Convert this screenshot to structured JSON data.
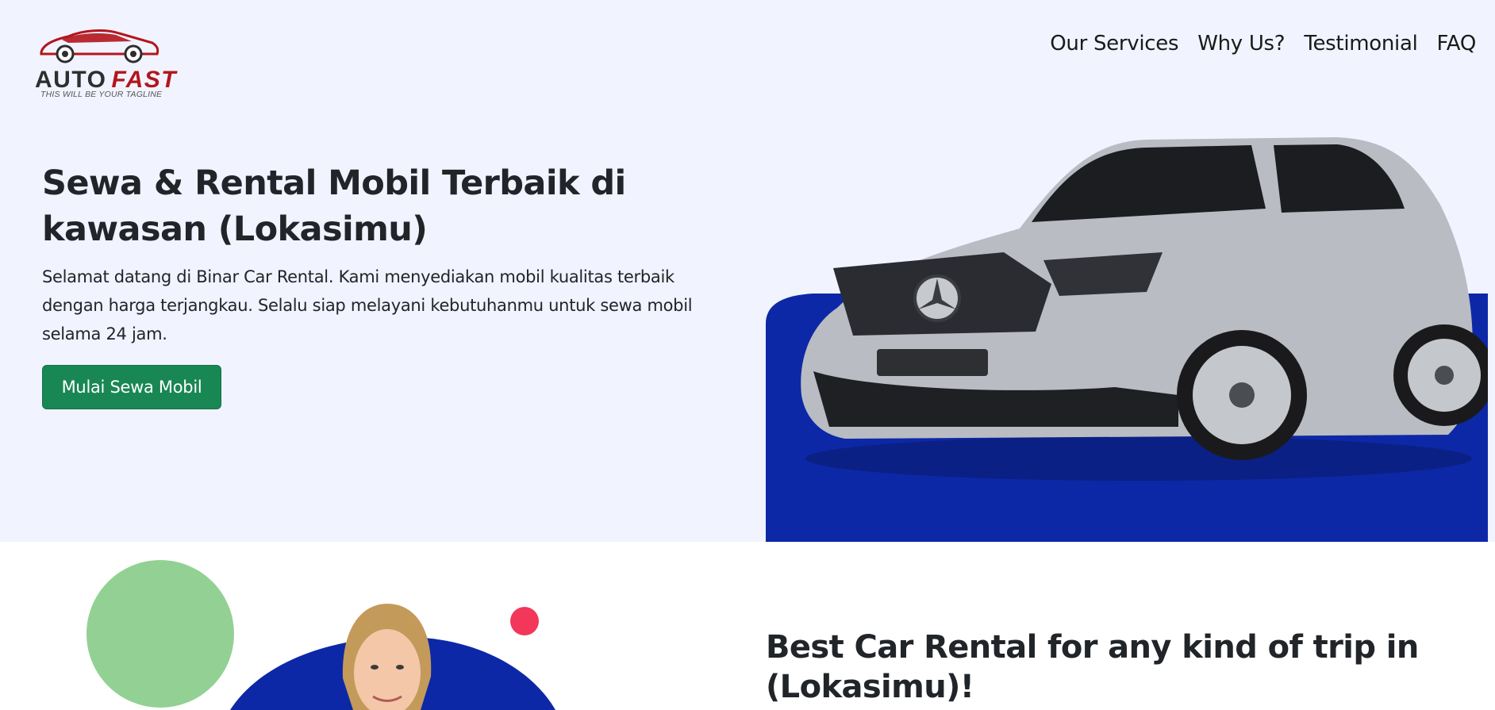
{
  "brand": {
    "name_part1": "AUTO",
    "name_part2": "FAST",
    "tagline": "THIS WILL BE YOUR TAGLINE",
    "logo_color": "#b3151c"
  },
  "nav": {
    "items": [
      {
        "label": "Our Services"
      },
      {
        "label": "Why Us?"
      },
      {
        "label": "Testimonial"
      },
      {
        "label": "FAQ"
      }
    ]
  },
  "hero": {
    "title": "Sewa & Rental Mobil Terbaik di kawasan (Lokasimu)",
    "description": "Selamat datang di Binar Car Rental. Kami menyediakan mobil kualitas terbaik dengan harga terjangkau. Selalu siap melayani kebutuhanmu untuk sewa mobil selama 24 jam.",
    "cta_label": "Mulai Sewa Mobil",
    "background_color": "#f1f3ff",
    "accent_color": "#0d28a6",
    "cta_color": "#198754"
  },
  "services": {
    "title": "Best Car Rental for any kind of trip in (Lokasimu)!",
    "decor_colors": {
      "green_circle": "#92d193",
      "red_dot": "#f2375a",
      "blue_arc": "#0d28a6"
    }
  }
}
